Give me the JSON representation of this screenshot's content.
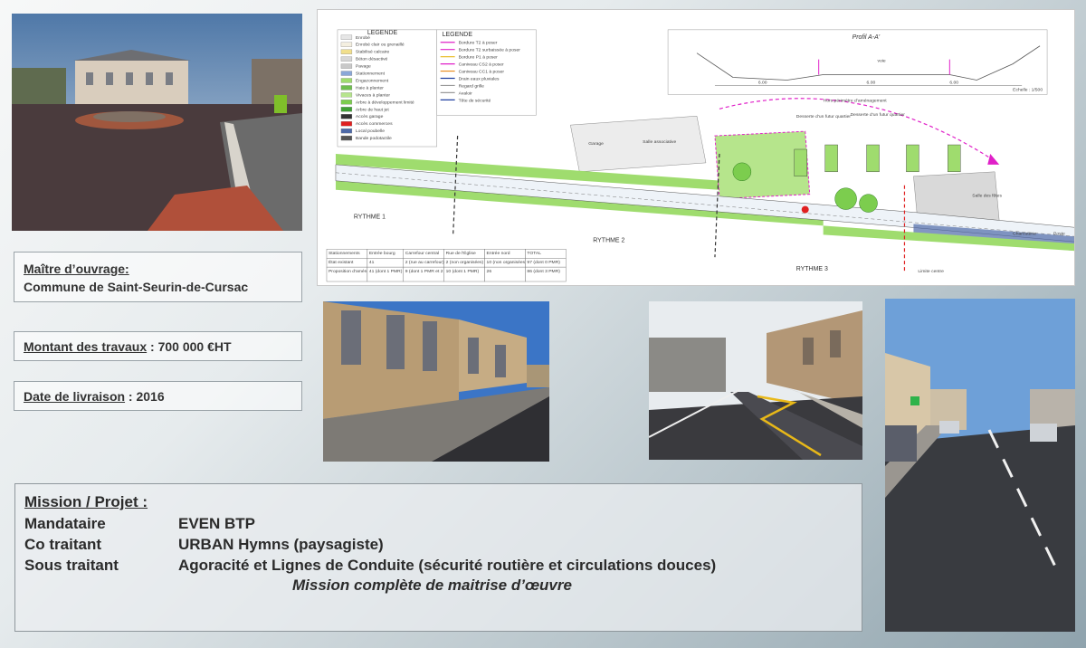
{
  "info": {
    "maitre_label": "Maître d’ouvrage:",
    "maitre_value": "Commune de Saint-Seurin-de-Cursac",
    "montant_label": "Montant des travaux",
    "montant_value": " : 700 000 €HT",
    "date_label": "Date de livraison",
    "date_value": " :  2016"
  },
  "mission": {
    "title": "Mission / Projet  :",
    "rows": [
      {
        "role": "Mandataire",
        "name": "EVEN BTP"
      },
      {
        "role": "Co traitant",
        "name": "URBAN Hymns (paysagiste)"
      },
      {
        "role": "Sous traitant",
        "name": "Agoracité et Lignes de Conduite (sécurité routière et circulations douces)"
      }
    ],
    "note": "Mission complète de maitrise d’œuvre"
  },
  "plan": {
    "legend_title": "LEGENDE",
    "legend_items": [
      "Enrobé",
      "Enrobé clair ou grenaillé",
      "Stabilisé calcaire",
      "Béton désactivé",
      "Pavage",
      "Stationnement",
      "Engazonnement",
      "Haie à planter",
      "Vivaces à planter",
      "Arbre à développement limité",
      "Arbre de haut jet",
      "Accès garage",
      "Accès commerces",
      "Local poubelle",
      "Bande podotactile"
    ],
    "legend2_title": "LEGENDE",
    "legend2_items": [
      "Bordure T2 à poser",
      "Bordure T2 surbaissée à poser",
      "Bordure P1 à poser",
      "Caniveau CS2 à poser",
      "Caniveau CC1 à poser",
      "Drain eaux pluviales",
      "Regard grille",
      "Avaloir",
      "Tête de sécurité"
    ],
    "profile_title": "Profil A-A'",
    "profile_scale": "Echelle : 1/500",
    "profile_dims": [
      "6.00",
      "6.00",
      "6.00"
    ],
    "profile_voie": "voie",
    "hors_perimetre": "Hors périmètre d’aménagement",
    "desserte_1": "Desserte d’un futur quartier",
    "desserte_2": "Desserte d’un futur quartier",
    "garage": "Garage",
    "salle_associative": "Salle associative",
    "salle_fetes": "Salle des fêtes",
    "charcuterie": "Charcuterie",
    "poste": "Poste",
    "rythme_1": "RYTHME 1",
    "rythme_2": "RYTHME 2",
    "rythme_3": "RYTHME 3",
    "limite": "Limite centre",
    "table_headers": [
      "Stationnements",
      "Entrée bourg",
      "Carrefour central",
      "Rue de l'Église",
      "Entrée nord",
      "TOTAL"
    ],
    "table_rows": [
      [
        "État existant",
        "41",
        "2 (rue au carrefour)",
        "2 (non organisées)",
        "10 (non organisées)",
        "97 (dont 0 PMR)"
      ],
      [
        "Proposition d'aménagement",
        "41 (dont 1 PMR)",
        "9 (dont 1 PMR et 2 face au carrefour)",
        "10 (dont 1 PMR)",
        "26",
        "86 (dont 3 PMR)"
      ]
    ]
  },
  "colors": {
    "magenta": "#e020c8",
    "green_hatch": "#9fdc6e",
    "road": "#4a4a52"
  }
}
